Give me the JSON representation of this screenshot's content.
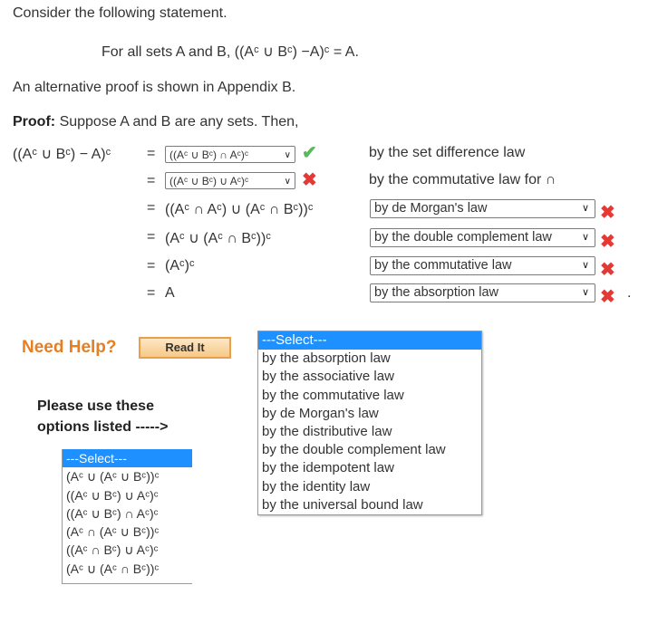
{
  "intro": "Consider the following statement.",
  "statement": "For all sets A and B, ((Aᶜ ∪ Bᶜ) −A)ᶜ = A.",
  "alternative": "An alternative proof is shown in Appendix B.",
  "proof_label": "Proof:",
  "proof_text": "Suppose A and B are any sets. Then,",
  "lhs": "((Aᶜ ∪ Bᶜ) − A)ᶜ",
  "equals": "=",
  "steps": [
    {
      "expr_select": "((Aᶜ ∪ Bᶜ) ∩ Aᶜ)ᶜ",
      "reason": "by the set difference law",
      "mark": "check"
    },
    {
      "expr_select": "((Aᶜ ∪ Bᶜ) ∪ Aᶜ)ᶜ",
      "reason": "by the commutative law for ∩",
      "mark": "cross"
    },
    {
      "expr": "((Aᶜ ∩ Aᶜ) ∪ (Aᶜ ∩ Bᶜ))ᶜ",
      "reason_select": "by de Morgan's law",
      "mark": "cross"
    },
    {
      "expr": "(Aᶜ ∪ (Aᶜ ∩ Bᶜ))ᶜ",
      "reason_select": "by the double complement law",
      "mark": "cross"
    },
    {
      "expr": "(Aᶜ)ᶜ",
      "reason_select": "by the commutative law",
      "mark": "cross"
    },
    {
      "expr": "A",
      "reason_select": "by the absorption law",
      "mark": "cross"
    }
  ],
  "end_dot": ".",
  "need_help": "Need Help?",
  "read_it": "Read It",
  "please_use": "Please use these",
  "options_listed": "options listed ----->",
  "reason_options": [
    "---Select---",
    "by the absorption law",
    "by the associative law",
    "by the commutative law",
    "by de Morgan's law",
    "by the distributive law",
    "by the double complement law",
    "by the idempotent law",
    "by the identity law",
    "by the universal bound law"
  ],
  "expr_options": [
    "---Select---",
    "(Aᶜ ∪ (Aᶜ ∪ Bᶜ))ᶜ",
    "((Aᶜ ∪ Bᶜ) ∪ Aᶜ)ᶜ",
    "((Aᶜ ∪ Bᶜ) ∩ Aᶜ)ᶜ",
    "(Aᶜ ∩ (Aᶜ ∪ Bᶜ))ᶜ",
    "((Aᶜ ∩ Bᶜ) ∪ Aᶜ)ᶜ",
    "(Aᶜ ∪ (Aᶜ ∩ Bᶜ))ᶜ"
  ],
  "icons": {
    "check": "checkmark-icon",
    "cross": "x-mark-icon",
    "chevron": "chevron-down-icon"
  },
  "colors": {
    "check": "#5cb85c",
    "cross": "#e53935",
    "help": "#e67e22",
    "highlight": "#1e90ff"
  }
}
